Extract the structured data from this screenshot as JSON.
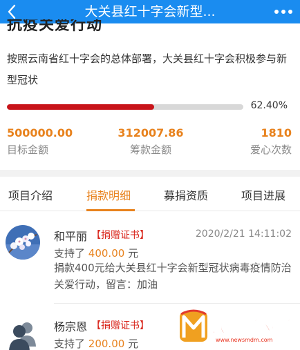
{
  "header": {
    "title": "大关县红十字会新型...",
    "back_icon": "chevron-left-icon",
    "more_icon": "more-dots-icon",
    "background": "#1a8cf0"
  },
  "project": {
    "heading_partial": "抗疫关爱行动",
    "description": "按照云南省红十字会的总体部署，大关县红十字会积极参与新型冠状",
    "progress_fraction": 0.624,
    "progress_label": "62.40%"
  },
  "stats": {
    "target": {
      "value": "500000.00",
      "label": "目标金额"
    },
    "raised": {
      "value": "312007.86",
      "label": "筹款金额"
    },
    "count": {
      "value": "1810",
      "label": "爱心次数"
    }
  },
  "tabs": [
    {
      "label": "项目介绍",
      "active": false
    },
    {
      "label": "捐款明细",
      "active": true
    },
    {
      "label": "募捐资质",
      "active": false
    },
    {
      "label": "项目进展",
      "active": false
    }
  ],
  "donations": [
    {
      "name": "和平丽",
      "certificate": "【捐赠证书】",
      "time": "2020/2/21 14:11:02",
      "amount_prefix": "支持了",
      "amount": "400.00",
      "amount_suffix": "元",
      "message": "捐款400元给大关县红十字会新型冠状病毒疫情防治关爱行动，留言：加油",
      "avatar": "blossom-photo"
    },
    {
      "name": "杨宗恩",
      "certificate": "【捐赠证书】",
      "amount_prefix": "支持了",
      "amount": "200.00",
      "amount_suffix": "元",
      "avatar": "default-users-icon"
    }
  ],
  "watermark": {
    "brand": "民声面对面",
    "site": "www.newsmdm.com"
  },
  "colors": {
    "accent": "#e8821d",
    "progress": "#c8141a",
    "certificate": "#d9261c"
  }
}
